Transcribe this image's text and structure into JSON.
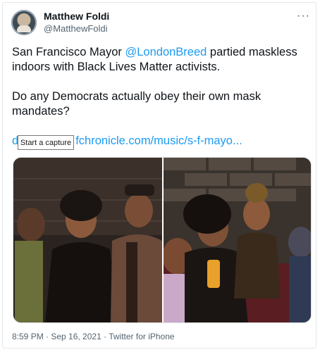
{
  "author": {
    "name": "Matthew Foldi",
    "handle": "@MatthewFoldi"
  },
  "more_label": "···",
  "tweet": {
    "line1_pre": "San Francisco Mayor ",
    "mention": "@LondonBreed",
    "line1_post": " partied maskless indoors with Black Lives Matter activists.",
    "line2": "Do any Democrats actually obey their own mask mandates?",
    "link_start": "d",
    "link_rest": "fchronicle.com/music/s-f-mayo..."
  },
  "tooltip": "Start a capture",
  "meta": {
    "timestamp": "8:59 PM · Sep 16, 2021 · Twitter for iPhone"
  }
}
